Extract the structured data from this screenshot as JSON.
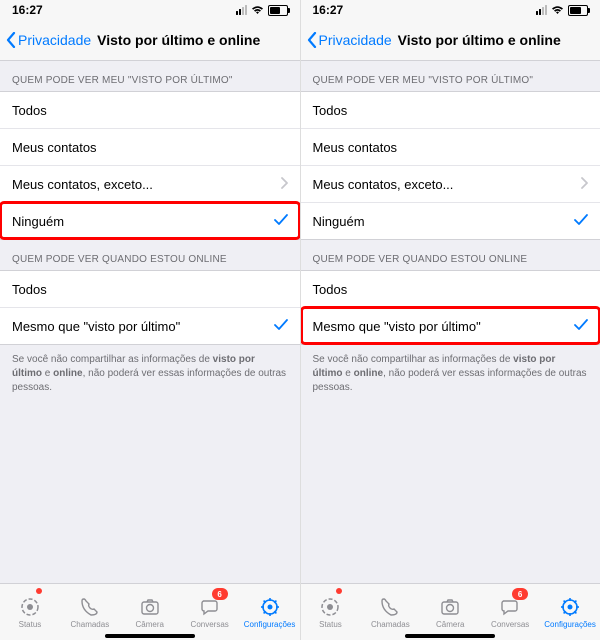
{
  "status": {
    "time": "16:27"
  },
  "nav": {
    "back_label": "Privacidade",
    "title": "Visto por último e online"
  },
  "section1": {
    "header": "QUEM PODE VER MEU \"VISTO POR ÚLTIMO\"",
    "opt_all": "Todos",
    "opt_contacts": "Meus contatos",
    "opt_except": "Meus contatos, exceto...",
    "opt_none": "Ninguém"
  },
  "section2": {
    "header": "QUEM PODE VER QUANDO ESTOU ONLINE",
    "opt_all": "Todos",
    "opt_same": "Mesmo que \"visto por último\""
  },
  "footnote": {
    "pre": "Se você não compartilhar as informações de ",
    "b1": "visto por último",
    "mid": " e ",
    "b2": "online",
    "post": ", não poderá ver essas informações de outras pessoas."
  },
  "tabs": {
    "status": "Status",
    "calls": "Chamadas",
    "camera": "Câmera",
    "chats": "Conversas",
    "settings": "Configurações",
    "badge_chats": "6"
  },
  "highlight_left": "ninguem",
  "highlight_right": "mesmo"
}
